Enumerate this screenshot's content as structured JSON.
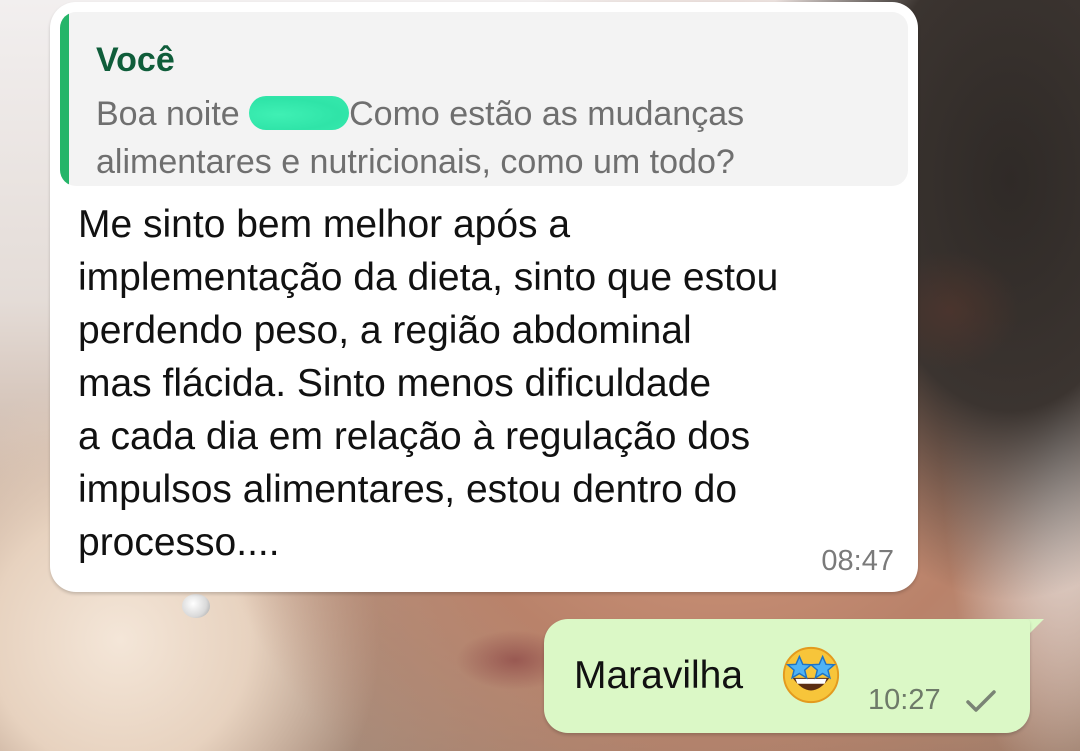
{
  "chat": {
    "incoming": {
      "quote": {
        "author": "Você",
        "text_before": "Boa noite ",
        "text_after": "Como estão as mudanças alimentares e nutricionais, como um todo?"
      },
      "message": "Me sinto bem melhor após a\nimplementação da dieta, sinto que estou\nperdendo peso, a região abdominal\nmas flácida. Sinto menos dificuldade\na cada dia em relação à regulação dos\nimpulsos alimentares, estou dentro do\nprocesso....",
      "time": "08:47"
    },
    "outgoing": {
      "message": "Maravilha",
      "emoji": "star-struck-emoji",
      "time": "10:27",
      "status_icon": "single-check-icon"
    }
  },
  "colors": {
    "incoming_bubble": "#ffffff",
    "outgoing_bubble": "#dbf8c6",
    "quote_bar": "#25b569",
    "quote_author": "#0f5d3a",
    "redaction": "#2fe4a8"
  }
}
